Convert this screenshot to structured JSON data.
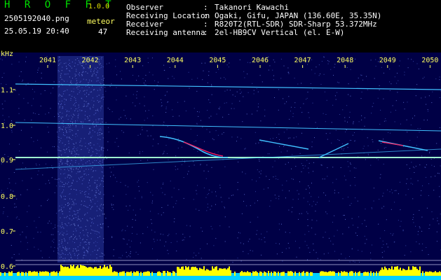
{
  "header": {
    "app_title": "H R O F F T",
    "app_version": "1.0.0",
    "filename": "2505192040.png",
    "datetime": "25.05.19 20:40",
    "meteor_label": "meteor",
    "meteor_count": "47",
    "info": [
      {
        "key": "Observer",
        "value": "Takanori Kawachi"
      },
      {
        "key": "Receiving Location",
        "value": "Ogaki, Gifu, JAPAN (136.60E, 35.35N)"
      },
      {
        "key": "Receiver",
        "value": "R820T2(RTL-SDR) SDR-Sharp 53.372MHz"
      },
      {
        "key": "Receiving antenna",
        "value": "2el-HB9CV Vertical (el. E-W)"
      }
    ]
  },
  "spectrogram": {
    "y_unit": "kHz",
    "time_ticks": [
      "2041",
      "2042",
      "2043",
      "2044",
      "2045",
      "2046",
      "2047",
      "2048",
      "2049",
      "2050"
    ],
    "freq_ticks": [
      "1.1",
      "1.0",
      "0.9",
      "0.8",
      "0.7",
      "0.6"
    ],
    "colors": {
      "background": "#000046",
      "label": "#ffff60",
      "trace": "#40c0ff",
      "echo": "#ff2060",
      "bar_low": "#00d0ff",
      "bar_high": "#ffff00"
    }
  }
}
